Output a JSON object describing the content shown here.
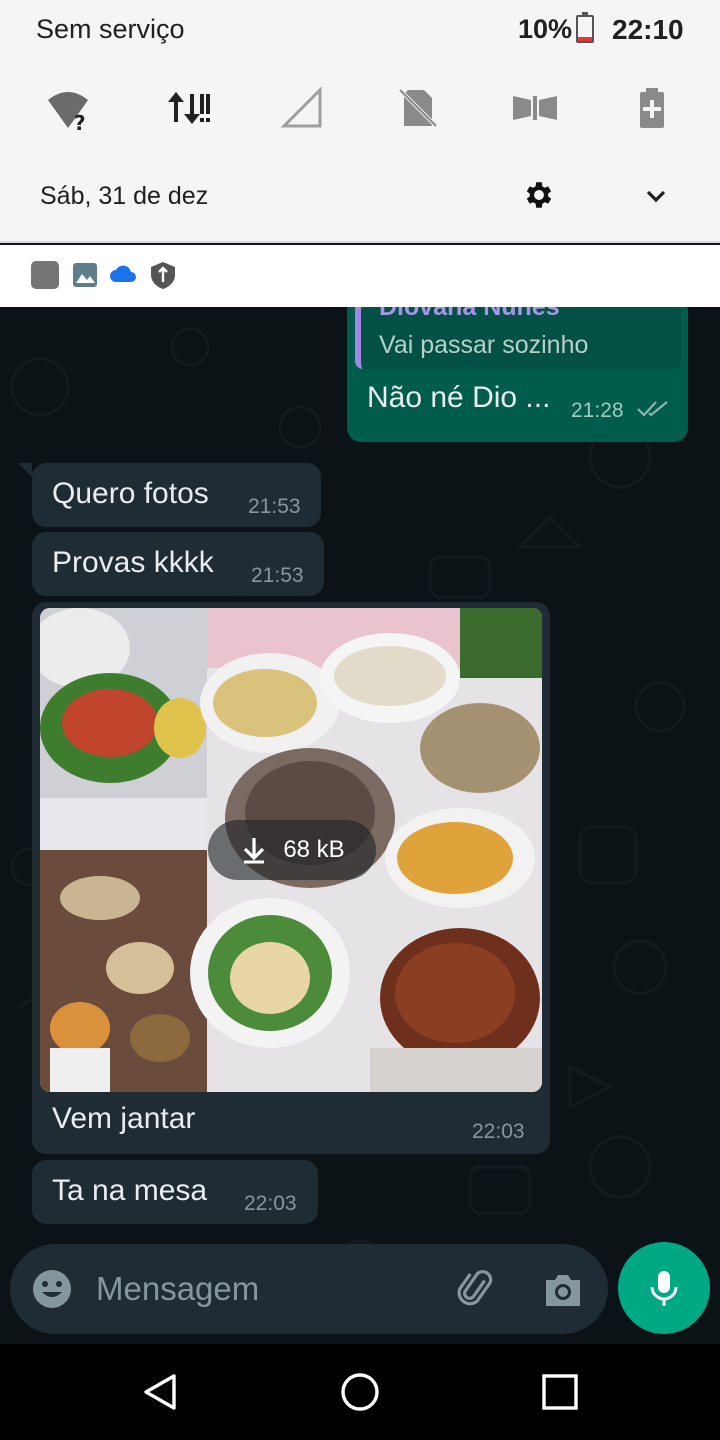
{
  "status_bar": {
    "carrier": "Sem serviço",
    "battery": "10%",
    "time": "22:10"
  },
  "quick_settings": {
    "date": "Sáb, 31 de dez",
    "tiles": [
      "wifi-unknown-icon",
      "mobile-data-icon",
      "signal-icon",
      "sim-off-icon",
      "flip-icon",
      "battery-saver-icon"
    ]
  },
  "notifications": {
    "icons": [
      "app-square-icon",
      "gallery-icon",
      "cloud-icon",
      "vpn-shield-icon"
    ]
  },
  "chat": {
    "messages": [
      {
        "direction": "out",
        "quoted_author": "Diovana Nunes",
        "quoted_text": "Vai passar sozinho",
        "text": "Não né Dio ...",
        "time": "21:28",
        "status": "read"
      },
      {
        "direction": "in",
        "text": "Quero fotos",
        "time": "21:53"
      },
      {
        "direction": "in",
        "text": "Provas kkkk",
        "time": "21:53"
      },
      {
        "direction": "in",
        "type": "image",
        "download_size": "68 kB",
        "caption": "Vem jantar",
        "time": "22:03"
      },
      {
        "direction": "in",
        "text": "Ta na mesa",
        "time": "22:03"
      }
    ]
  },
  "composer": {
    "placeholder": "Mensagem"
  },
  "colors": {
    "chat_bg": "#0c1317",
    "incoming_bubble": "#202c33",
    "outgoing_bubble": "#005c4b",
    "accent": "#00a884"
  }
}
